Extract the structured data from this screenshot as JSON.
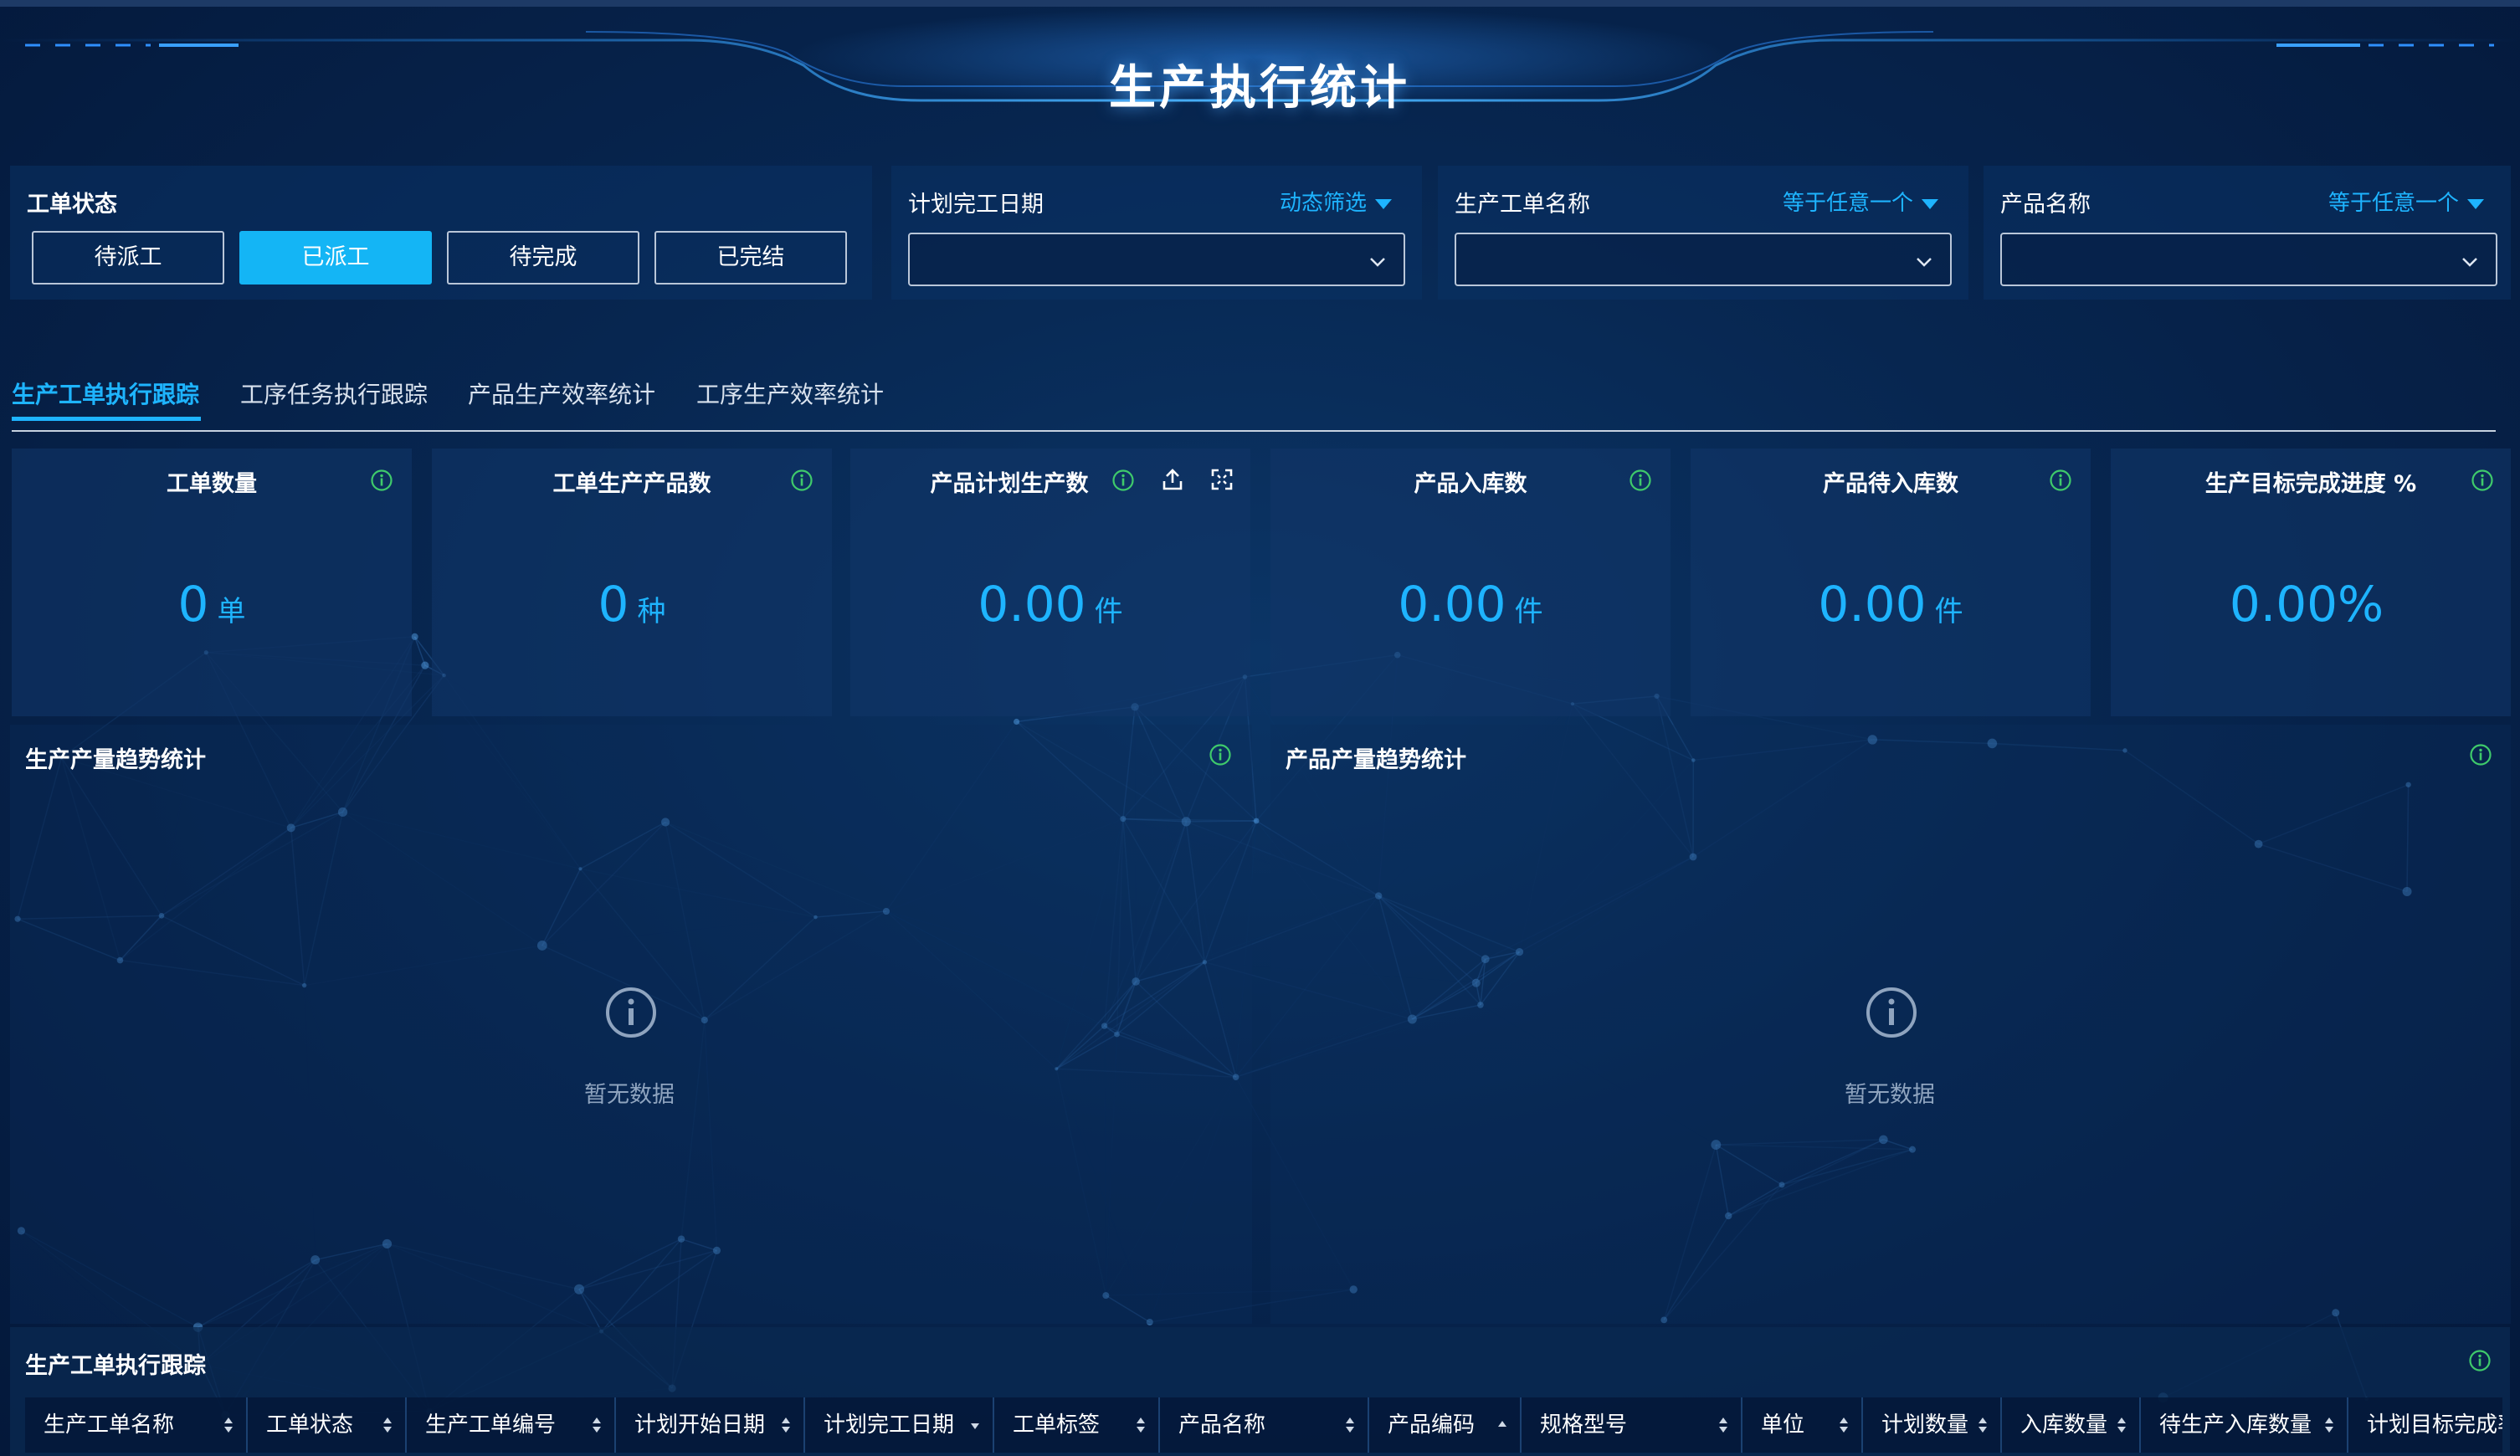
{
  "header": {
    "title": "生产执行统计"
  },
  "filters": {
    "work_order_status": {
      "label": "工单状态",
      "options": [
        "待派工",
        "已派工",
        "待完成",
        "已完结"
      ],
      "selected": "已派工"
    },
    "plan_finish_date": {
      "label": "计划完工日期",
      "mode": "动态筛选",
      "value": ""
    },
    "work_order_name": {
      "label": "生产工单名称",
      "mode": "等于任意一个",
      "value": ""
    },
    "product_name": {
      "label": "产品名称",
      "mode": "等于任意一个",
      "value": ""
    }
  },
  "tabs": [
    {
      "label": "生产工单执行跟踪",
      "active": true
    },
    {
      "label": "工序任务执行跟踪",
      "active": false
    },
    {
      "label": "产品生产效率统计",
      "active": false
    },
    {
      "label": "工序生产效率统计",
      "active": false
    }
  ],
  "kpis": [
    {
      "title": "工单数量",
      "value": "0",
      "unit": "单"
    },
    {
      "title": "工单生产产品数",
      "value": "0",
      "unit": "种"
    },
    {
      "title": "产品计划生产数",
      "value": "0.00",
      "unit": "件"
    },
    {
      "title": "产品入库数",
      "value": "0.00",
      "unit": "件"
    },
    {
      "title": "产品待入库数",
      "value": "0.00",
      "unit": "件"
    },
    {
      "title": "生产目标完成进度 %",
      "value": "0.00%",
      "unit": ""
    }
  ],
  "charts": [
    {
      "title": "生产产量趋势统计",
      "empty_text": "暂无数据"
    },
    {
      "title": "产品产量趋势统计",
      "empty_text": "暂无数据"
    }
  ],
  "table": {
    "title": "生产工单执行跟踪",
    "columns": [
      "生产工单名称",
      "工单状态",
      "生产工单编号",
      "计划开始日期",
      "计划完工日期",
      "工单标签",
      "产品名称",
      "产品编码",
      "规格型号",
      "单位",
      "计划数量",
      "入库数量",
      "待生产入库数量",
      "计划目标完成率"
    ]
  },
  "colors": {
    "accent": "#1eb4ff",
    "active_button": "#14b5f5",
    "info_icon": "#3fca6b",
    "background": "#072650"
  },
  "icons": [
    "info-icon",
    "upload-icon",
    "fullscreen-icon",
    "chevron-down-icon",
    "caret-down-icon",
    "sort-icon",
    "empty-info-icon"
  ]
}
